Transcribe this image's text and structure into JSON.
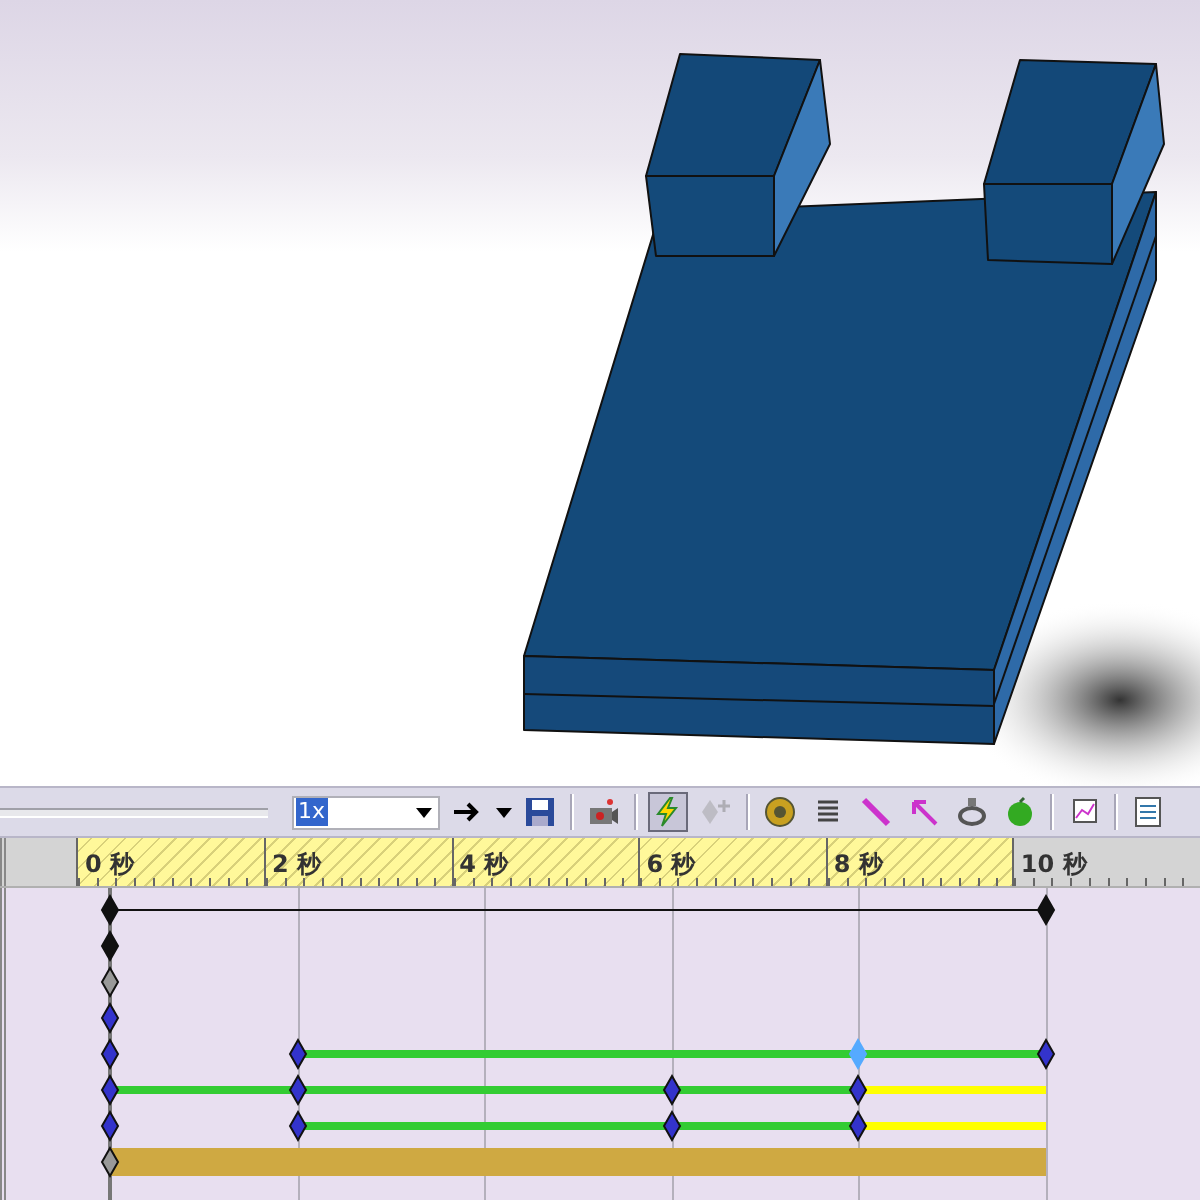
{
  "toolbar": {
    "playback_speed": "1x",
    "calculate": {
      "pressed": true
    },
    "add_key": {
      "disabled": true
    }
  },
  "ruler": {
    "labels": [
      "0 秒",
      "2 秒",
      "4 秒",
      "6 秒",
      "8 秒",
      "10 秒"
    ]
  },
  "tracks": [
    {
      "start_key": {
        "kind": "black"
      },
      "intervals": [
        {
          "kind": "line"
        },
        {
          "kind": "line"
        },
        {
          "kind": "line"
        },
        {
          "kind": "line"
        },
        {
          "kind": "line",
          "end_key": {
            "kind": "black"
          }
        }
      ]
    },
    {
      "start_key": {
        "kind": "black"
      }
    },
    {
      "start_key": {
        "kind": "gray"
      }
    },
    {
      "start_key": {
        "kind": "blue"
      }
    },
    {
      "start_key": {
        "kind": "blue"
      },
      "intervals": [
        {
          "end_key": {
            "kind": "blue"
          }
        },
        {
          "kind": "change"
        },
        {
          "kind": "change"
        },
        {
          "kind": "change",
          "end_key": {
            "kind": "selected"
          }
        },
        {
          "kind": "change",
          "end_key": {
            "kind": "blue"
          }
        }
      ]
    },
    {
      "start_key": {
        "kind": "blue"
      },
      "intervals": [
        {
          "kind": "change",
          "end_key": {
            "kind": "blue"
          }
        },
        {
          "kind": "change"
        },
        {
          "kind": "change",
          "end_key": {
            "kind": "blue"
          }
        },
        {
          "kind": "change",
          "end_key": {
            "kind": "blue"
          }
        },
        {
          "kind": "hold"
        }
      ]
    },
    {
      "start_key": {
        "kind": "blue"
      },
      "intervals": [
        {
          "end_key": {
            "kind": "blue"
          }
        },
        {
          "kind": "change"
        },
        {
          "kind": "change",
          "end_key": {
            "kind": "blue"
          }
        },
        {
          "kind": "change",
          "end_key": {
            "kind": "blue"
          }
        },
        {
          "kind": "hold"
        }
      ]
    },
    {
      "start_key": {
        "kind": "gray"
      },
      "intervals": [
        {
          "kind": "bar"
        },
        {
          "kind": "bar"
        },
        {
          "kind": "bar"
        },
        {
          "kind": "bar"
        },
        {
          "kind": "bar"
        }
      ]
    }
  ]
}
